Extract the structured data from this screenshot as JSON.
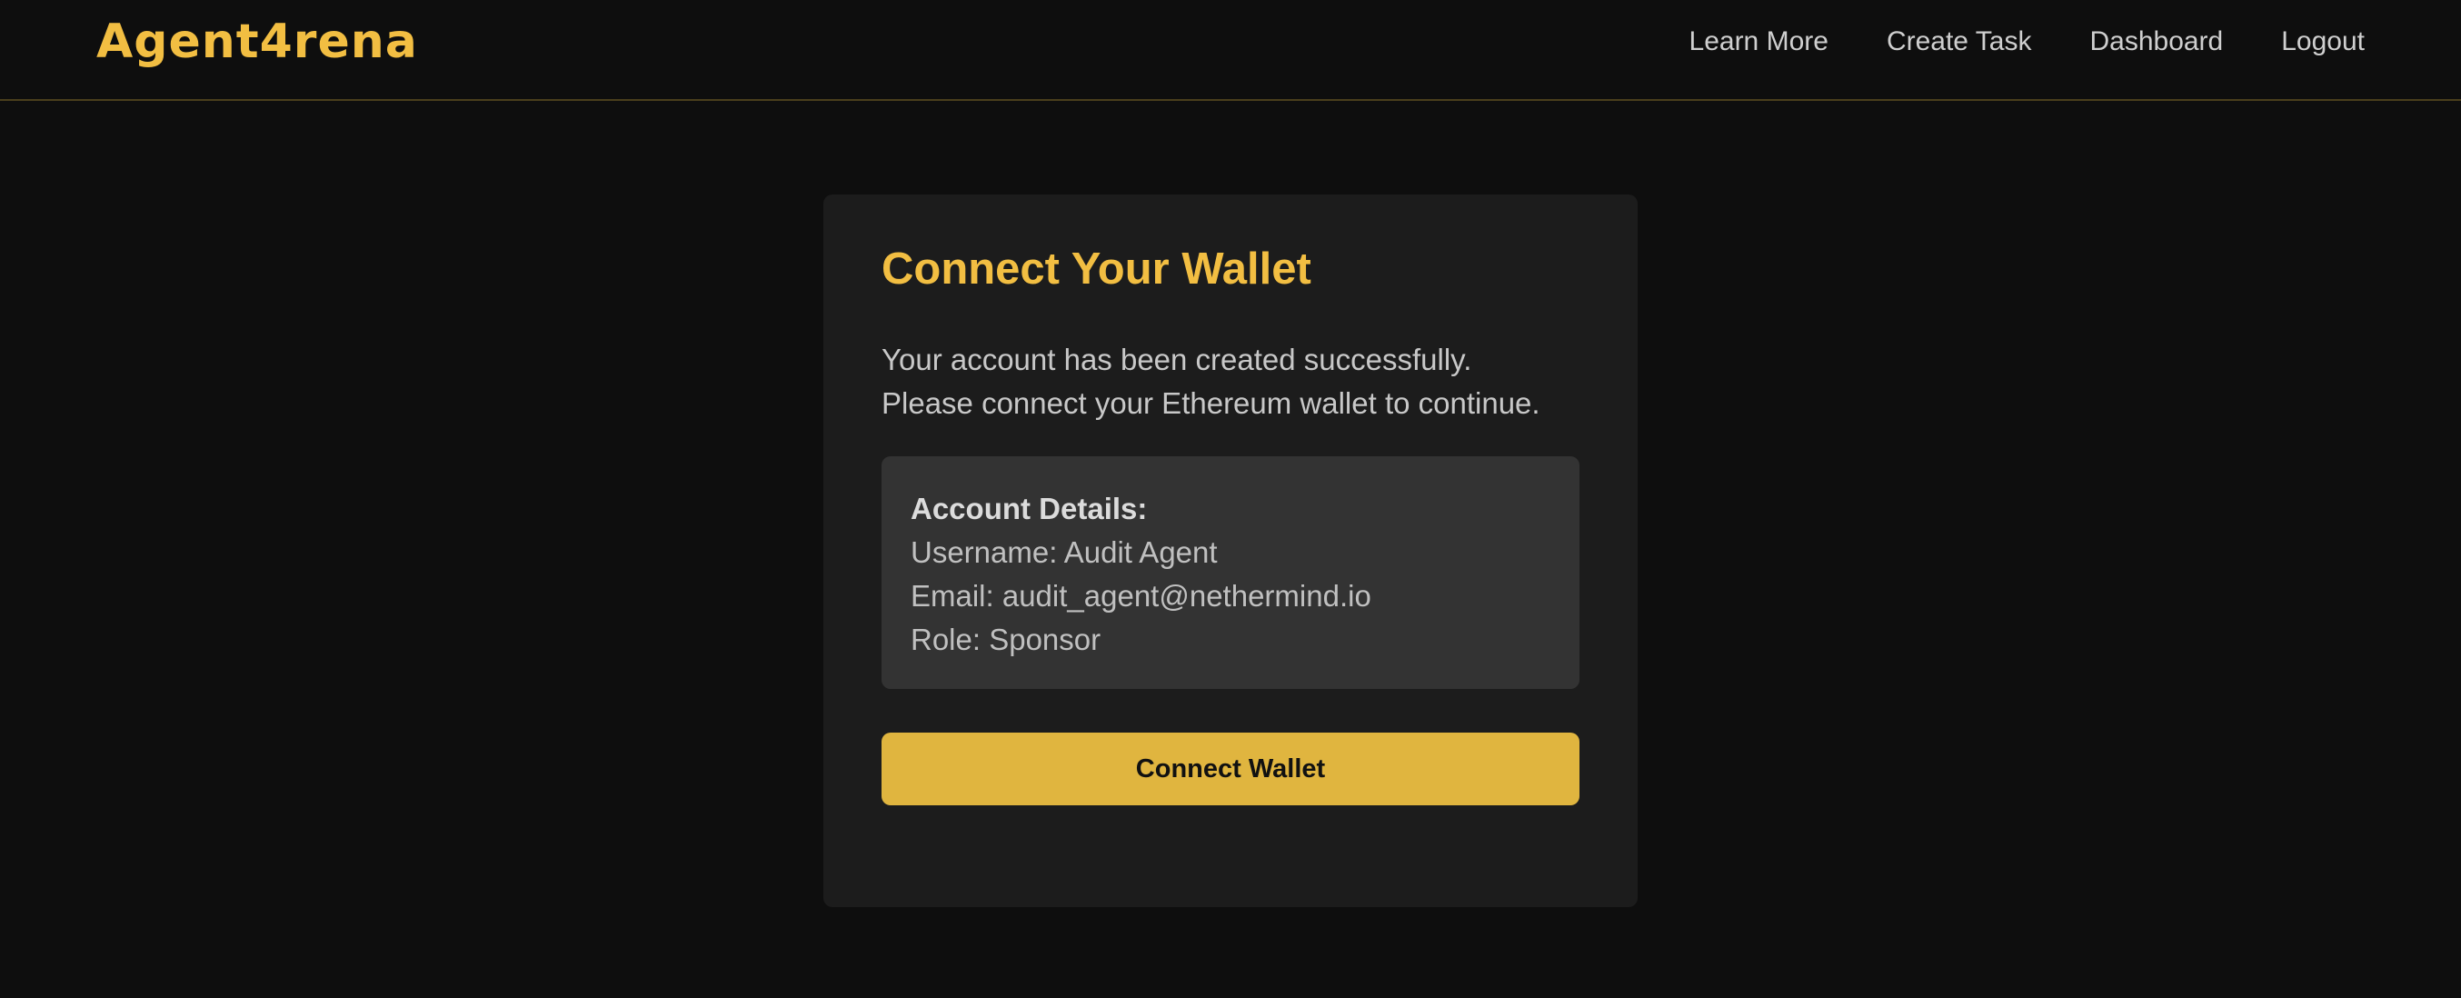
{
  "header": {
    "logo_text": "Agent4rena",
    "nav": [
      {
        "label": "Learn More"
      },
      {
        "label": "Create Task"
      },
      {
        "label": "Dashboard"
      },
      {
        "label": "Logout"
      }
    ]
  },
  "card": {
    "title": "Connect Your Wallet",
    "message_line1": "Your account has been created successfully.",
    "message_line2": "Please connect your Ethereum wallet to continue.",
    "details": {
      "heading": "Account Details:",
      "username": "Username: Audit Agent",
      "email": "Email: audit_agent@nethermind.io",
      "role": "Role: Sponsor"
    },
    "button_label": "Connect Wallet"
  },
  "colors": {
    "background": "#0e0e0e",
    "card": "#1c1c1c",
    "details_box": "#333333",
    "accent": "#f2be42",
    "button": "#e0b53f"
  }
}
